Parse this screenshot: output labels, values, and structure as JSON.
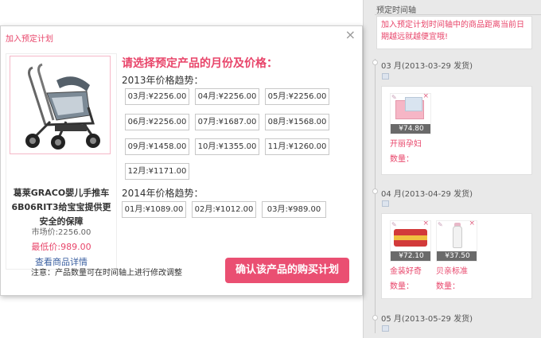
{
  "timeline": {
    "title": "预定时间轴",
    "note": "加入预定计划时间轴中的商品距离当前日期越远就越便宜哦!",
    "months": [
      {
        "label": "03 月(2013-03-29 发货)",
        "products": [
          {
            "price": "¥74.80",
            "name": "开丽孕妇",
            "qty_label": "数量："
          }
        ]
      },
      {
        "label": "04 月(2013-04-29 发货)",
        "products": [
          {
            "price": "¥72.10",
            "name": "金装好奇",
            "qty_label": "数量："
          },
          {
            "price": "¥37.50",
            "name": "贝亲标准",
            "qty_label": "数量："
          }
        ]
      },
      {
        "label": "05 月(2013-05-29 发货)",
        "products": []
      }
    ]
  },
  "modal": {
    "title": "加入预定计划",
    "close_symbol": "×",
    "product": {
      "name": "葛莱GRACO婴儿手推车6B06RIT3给宝宝提供更安全的保障",
      "market_price": "市场价:2256.00",
      "lowest_price": "最低价:989.00",
      "details_link": "查看商品详情"
    },
    "heading": "请选择预定产品的月份及价格：",
    "years": [
      {
        "label": "2013年价格趋势：",
        "prices": [
          "03月:¥2256.00",
          "04月:¥2256.00",
          "05月:¥2256.00",
          "06月:¥2256.00",
          "07月:¥1687.00",
          "08月:¥1568.00",
          "09月:¥1458.00",
          "10月:¥1355.00",
          "11月:¥1260.00",
          "12月:¥1171.00"
        ]
      },
      {
        "label": "2014年价格趋势：",
        "prices": [
          "01月:¥1089.00",
          "02月:¥1012.00",
          "03月:¥989.00"
        ]
      }
    ],
    "note": "注意：产品数量可在时间轴上进行修改调整",
    "confirm_button": "确认该产品的购买计划"
  },
  "colors": {
    "accent": "#e8456a",
    "button": "#ea4f72",
    "link": "#3a5fa0",
    "sidebar_bg": "#e9e9e9"
  },
  "icons": [
    "close-icon",
    "document-icon",
    "pin-icon",
    "remove-icon",
    "stroller-image"
  ]
}
